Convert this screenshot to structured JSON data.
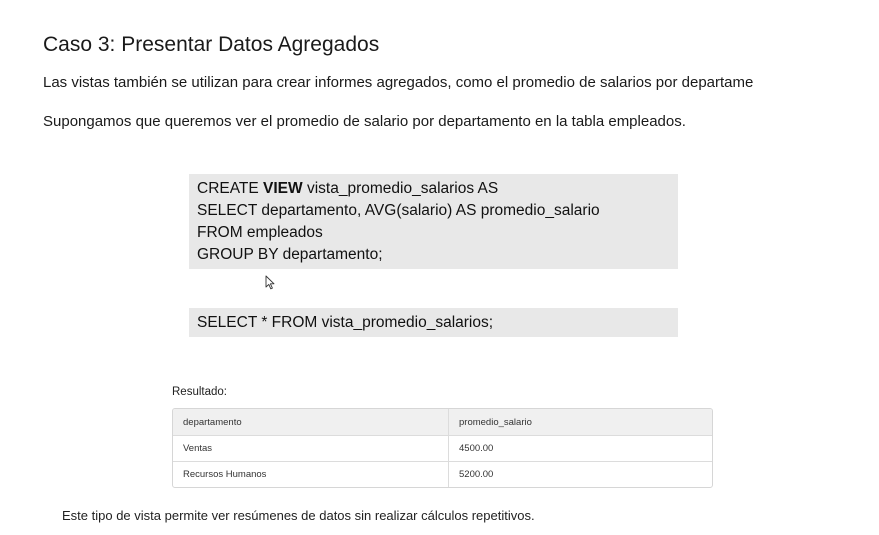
{
  "heading": "Caso 3: Presentar Datos Agregados",
  "paragraphs": {
    "intro": "Las vistas también se utilizan para crear informes agregados, como el promedio de salarios por departame",
    "suppose": "Supongamos que queremos ver el promedio de salario por departamento en la tabla empleados."
  },
  "code_block_1": {
    "line1_pre": "CREATE ",
    "line1_kw": "VIEW",
    "line1_post": " vista_promedio_salarios AS",
    "line2": "SELECT departamento, AVG(salario) AS promedio_salario",
    "line3": "FROM empleados",
    "line4": "GROUP BY departamento;"
  },
  "code_block_2": {
    "line1": "SELECT * FROM vista_promedio_salarios;"
  },
  "result": {
    "label": "Resultado:",
    "columns": [
      "departamento",
      "promedio_salario"
    ],
    "rows": [
      [
        "Ventas",
        "4500.00"
      ],
      [
        "Recursos Humanos",
        "5200.00"
      ]
    ]
  },
  "footer": "Este tipo de vista permite ver resúmenes de datos sin realizar cálculos repetitivos."
}
